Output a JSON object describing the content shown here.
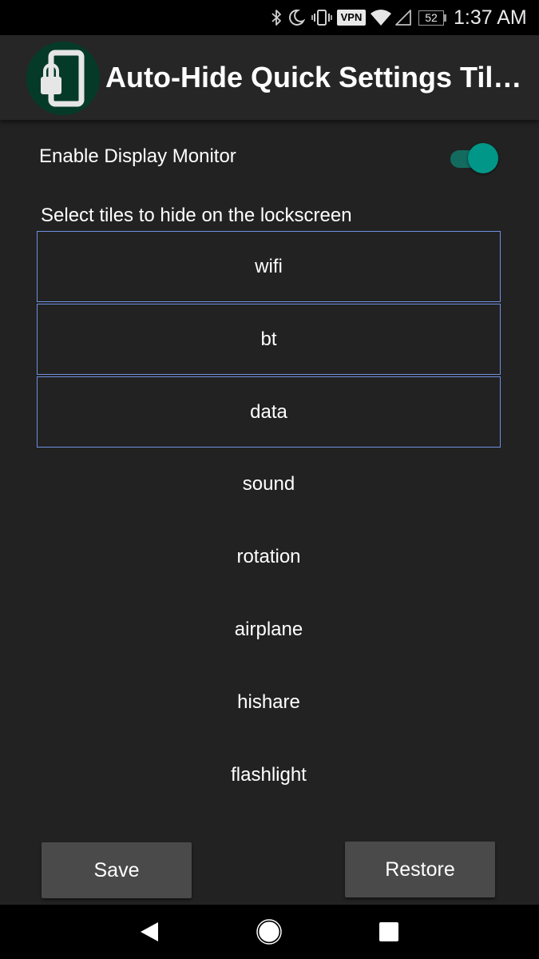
{
  "status_bar": {
    "icons": [
      "bluetooth-icon",
      "do-not-disturb-moon-icon",
      "vibrate-icon",
      "vpn-icon",
      "wifi-icon",
      "cell-signal-icon",
      "battery-icon"
    ],
    "vpn_label": "VPN",
    "battery_level": "52",
    "time": "1:37 AM"
  },
  "app_bar": {
    "title": "Auto-Hide Quick Settings Til…",
    "logo_icon": "phone-lock-icon",
    "logo_bg_color": "#053a29",
    "logo_accent_color": "#e6e6e6"
  },
  "settings": {
    "monitor_label": "Enable Display Monitor",
    "monitor_enabled": true,
    "switch_color": "#009688"
  },
  "tiles": {
    "header": "Select tiles to hide on the lockscreen",
    "selection_border_color": "#6f8fe0",
    "items": [
      {
        "label": "wifi",
        "selected": true
      },
      {
        "label": "bt",
        "selected": true
      },
      {
        "label": "data",
        "selected": true
      },
      {
        "label": "sound",
        "selected": false
      },
      {
        "label": "rotation",
        "selected": false
      },
      {
        "label": "airplane",
        "selected": false
      },
      {
        "label": "hishare",
        "selected": false
      },
      {
        "label": "flashlight",
        "selected": false
      }
    ]
  },
  "actions": {
    "save_label": "Save",
    "restore_label": "Restore"
  },
  "nav_bar": {
    "buttons": [
      "back-icon",
      "home-icon",
      "recents-icon"
    ]
  }
}
